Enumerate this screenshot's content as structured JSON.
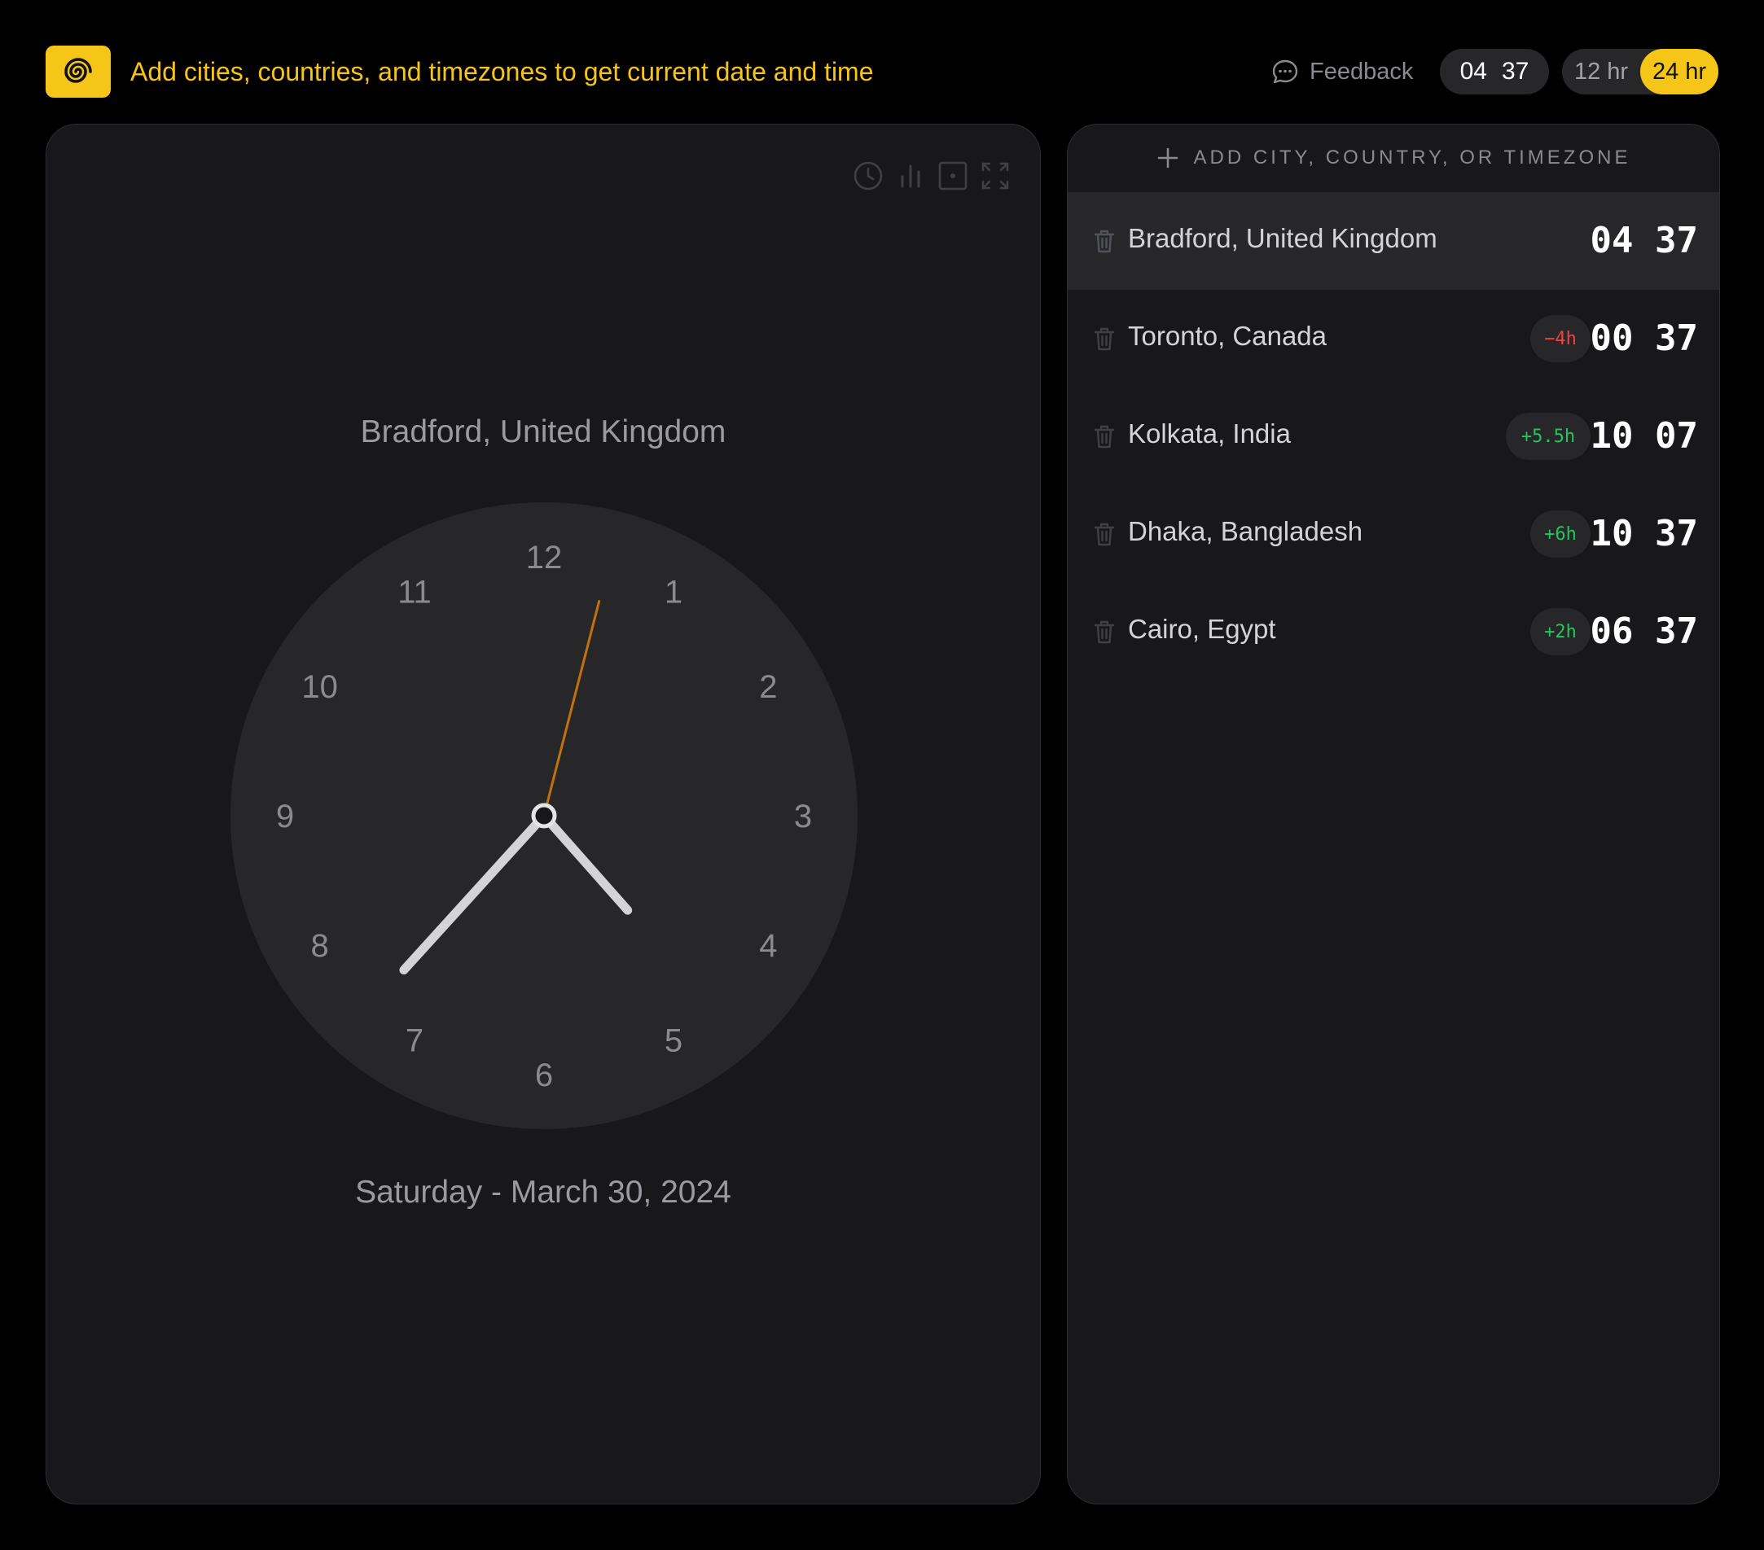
{
  "header": {
    "logo_icon": "spiral-logo-icon",
    "tagline": "Add cities, countries, and timezones to get current date and time",
    "feedback_label": "Feedback",
    "current_time": {
      "hours": "04",
      "minutes": "37"
    },
    "format_toggle": {
      "option_12": "12 hr",
      "option_24": "24 hr",
      "selected": "24 hr"
    }
  },
  "main": {
    "tools": [
      "clock-icon",
      "bar-chart-icon",
      "focus-icon",
      "fullscreen-icon"
    ],
    "city_title": "Bradford, United Kingdom",
    "clock_face": {
      "numbers": [
        "12",
        "1",
        "2",
        "3",
        "4",
        "5",
        "6",
        "7",
        "8",
        "9",
        "10",
        "11"
      ],
      "hour": 4,
      "minute": 37,
      "second": 2.4
    },
    "date": "Saturday - March 30, 2024"
  },
  "sidebar": {
    "add_label": "ADD CITY, COUNTRY, OR TIMEZONE",
    "cities": [
      {
        "name": "Bradford, United Kingdom",
        "offset": "",
        "time": "04 37"
      },
      {
        "name": "Toronto, Canada",
        "offset": "−4h",
        "time": "00 37"
      },
      {
        "name": "Kolkata, India",
        "offset": "+5.5h",
        "time": "10 07"
      },
      {
        "name": "Dhaka, Bangladesh",
        "offset": "+6h",
        "time": "10 37"
      },
      {
        "name": "Cairo, Egypt",
        "offset": "+2h",
        "time": "06 37"
      }
    ]
  },
  "colors": {
    "accent": "#f5c518",
    "negative": "#ef4444",
    "positive": "#22c55e",
    "second_hand": "#c2710c"
  }
}
